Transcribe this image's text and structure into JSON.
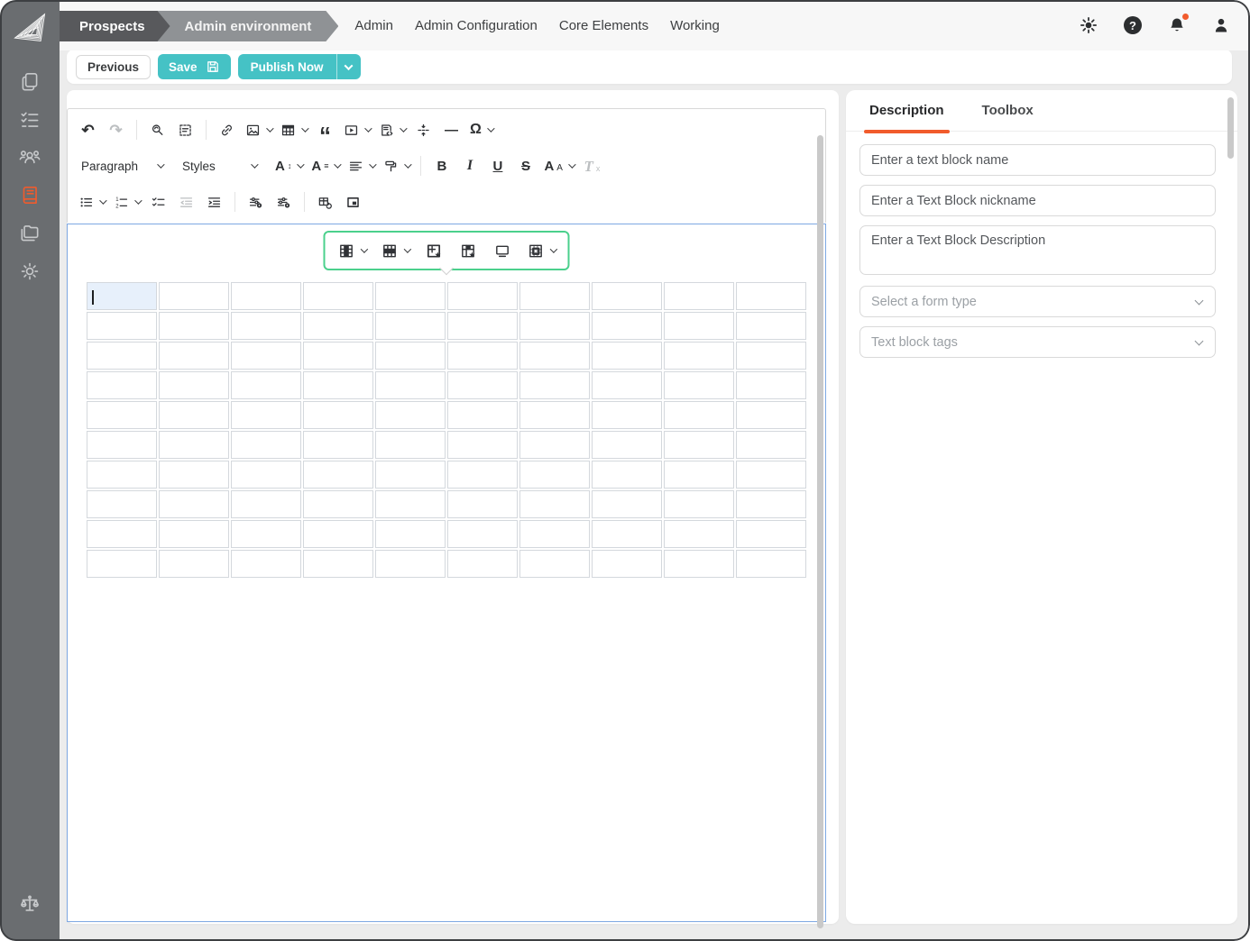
{
  "topbar": {
    "tabs": [
      {
        "label": "Prospects",
        "active": true
      },
      {
        "label": "Admin environment",
        "active": false
      }
    ],
    "nav": [
      "Admin",
      "Admin Configuration",
      "Core Elements",
      "Working"
    ],
    "right_icons": [
      "theme-toggle-icon",
      "help-icon",
      "notifications-bell-icon",
      "account-icon"
    ],
    "notification_badge": true
  },
  "sidebar": {
    "logo": "pyramid-logo",
    "items": [
      "documents-icon",
      "checklist-icon",
      "users-icon",
      "book-icon",
      "folder-icon",
      "settings-gear-icon"
    ],
    "active_item": "book-icon",
    "bottom_item": "scales-icon"
  },
  "actions": {
    "previous_label": "Previous",
    "save_label": "Save",
    "publish_label": "Publish Now"
  },
  "editor": {
    "toolbar": {
      "paragraph_label": "Paragraph",
      "styles_label": "Styles",
      "row1_icons": [
        "undo",
        "redo",
        "find-replace",
        "select-all",
        "link",
        "insert-image",
        "insert-table",
        "block-quote",
        "insert-media",
        "html-embed",
        "page-break",
        "horizontal-line",
        "special-characters"
      ],
      "row2_icons": [
        "paragraph-dropdown",
        "styles-dropdown",
        "font-size",
        "font-family",
        "alignment",
        "highlight",
        "bold",
        "italic",
        "underline",
        "strikethrough",
        "font-color",
        "remove-format"
      ],
      "row3_icons": [
        "bulleted-list",
        "numbered-list",
        "todo-list",
        "outdent",
        "indent",
        "insert-field",
        "insert-condition",
        "table-sync",
        "image-box"
      ]
    },
    "balloon_icons": [
      "table-column",
      "table-row",
      "merge-cells",
      "cell-properties",
      "toggle-caption",
      "table-properties"
    ],
    "table": {
      "rows": 10,
      "cols": 10,
      "selected_cell": {
        "row": 0,
        "col": 0
      }
    }
  },
  "panel": {
    "tabs": [
      {
        "label": "Description",
        "active": true
      },
      {
        "label": "Toolbox",
        "active": false
      }
    ],
    "fields": {
      "name_placeholder": "Enter a text block name",
      "nickname_placeholder": "Enter a Text Block nickname",
      "description_placeholder": "Enter a Text Block Description",
      "form_type_placeholder": "Select a form type",
      "tags_placeholder": "Text block tags"
    }
  },
  "glyphs": {
    "undo": "↶",
    "redo": "↷",
    "quote": "“",
    "omega": "Ω",
    "hr": "—",
    "bold": "B",
    "italic": "I",
    "underline": "U",
    "strike": "S",
    "letter_a": "A",
    "updown": "↕",
    "lines": "≡",
    "small_a": "A",
    "rf_t": "T",
    "rf_x": "x",
    "help": "?"
  },
  "colors": {
    "teal": "#45c2c5",
    "orange": "#f15b2c",
    "balloon_green": "#4bd08c",
    "focus_blue": "#7ea8e2",
    "selected_cell": "#e7f0fb",
    "sidebar_gray": "#6a6d70",
    "crumb_dark": "#58595c",
    "crumb_mid": "#8f9295"
  }
}
